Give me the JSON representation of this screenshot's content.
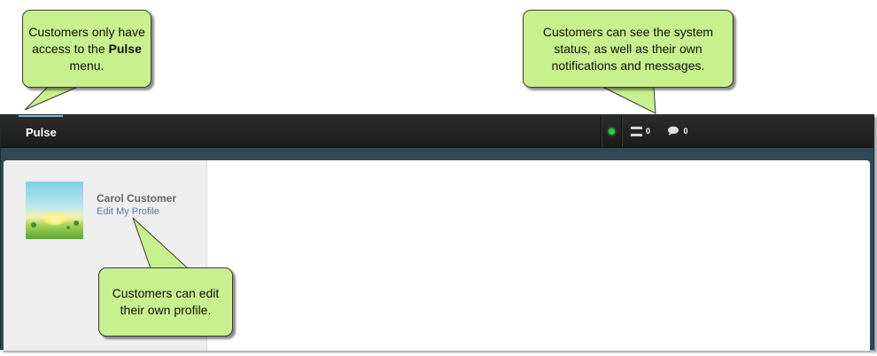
{
  "topbar": {
    "nav_item_pulse": "Pulse",
    "notifications_count": "0",
    "messages_count": "0"
  },
  "profile": {
    "name": "Carol Customer",
    "edit_link": "Edit My Profile"
  },
  "callouts": {
    "menu_prefix": "Customers only have access to the",
    "menu_bold": "Pulse",
    "menu_suffix": "menu.",
    "status": "Customers can see the system status, as well as their own notifications and messages.",
    "profile": "Customers can edit their own profile."
  },
  "icons": {
    "status": "status-dot-icon",
    "notifications": "notifications-icon",
    "messages": "speech-bubble-icon"
  },
  "colors": {
    "callout_fill": "#c8f08c",
    "status_ok": "#2ecc40",
    "link": "#4a7fa8",
    "header_bg": "#222222",
    "nav_underline": "#7fb7d8"
  }
}
